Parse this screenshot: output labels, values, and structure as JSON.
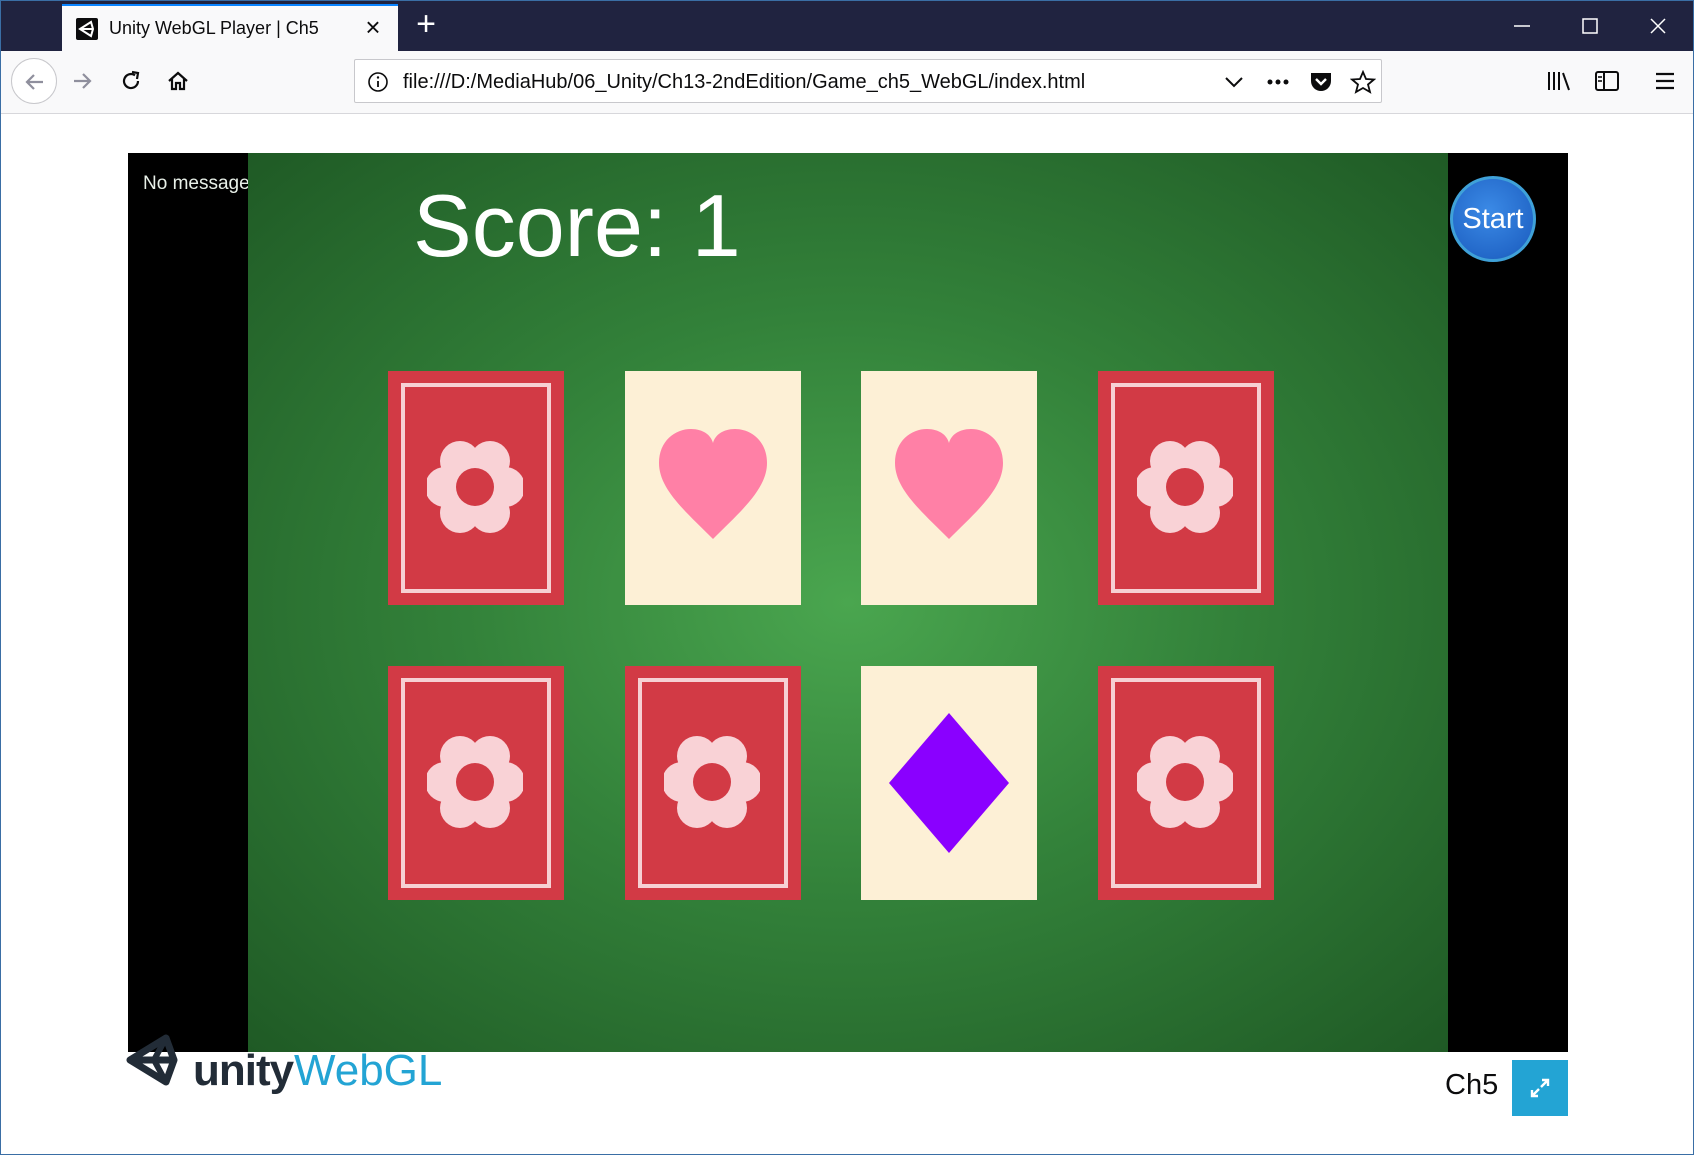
{
  "browser": {
    "tab_title": "Unity WebGL Player | Ch5",
    "url": "file:///D:/MediaHub/06_Unity/Ch13-2ndEdition/Game_ch5_WebGL/index.html",
    "icons": {
      "back": "arrow-left-icon",
      "forward": "arrow-right-icon",
      "reload": "reload-icon",
      "home": "home-icon",
      "info": "info-icon",
      "dropdown": "chevron-down-icon",
      "more": "ellipsis-icon",
      "pocket": "pocket-icon",
      "bookmark": "star-icon",
      "library": "library-icon",
      "sidebar": "sidebar-icon",
      "menu": "hamburger-menu-icon"
    },
    "accent_color": "#0a84ff",
    "titlebar_color": "#202340"
  },
  "game": {
    "message": "No message yet",
    "score_label": "Score: 1",
    "start_label": "Start",
    "cards": [
      {
        "row": 1,
        "col": 1,
        "face": "back"
      },
      {
        "row": 1,
        "col": 2,
        "face": "heart"
      },
      {
        "row": 1,
        "col": 3,
        "face": "heart"
      },
      {
        "row": 1,
        "col": 4,
        "face": "back"
      },
      {
        "row": 2,
        "col": 1,
        "face": "back"
      },
      {
        "row": 2,
        "col": 2,
        "face": "back"
      },
      {
        "row": 2,
        "col": 3,
        "face": "diamond"
      },
      {
        "row": 2,
        "col": 4,
        "face": "back"
      }
    ],
    "colors": {
      "card_back": "#d23a45",
      "card_front": "#fdf0d6",
      "heart": "#ff80a6",
      "diamond": "#8a00ff",
      "table": "#33823a"
    }
  },
  "footer": {
    "logo_unity": "unity",
    "logo_webgl": "WebGL",
    "title": "Ch5",
    "fullscreen_icon": "fullscreen-icon"
  }
}
